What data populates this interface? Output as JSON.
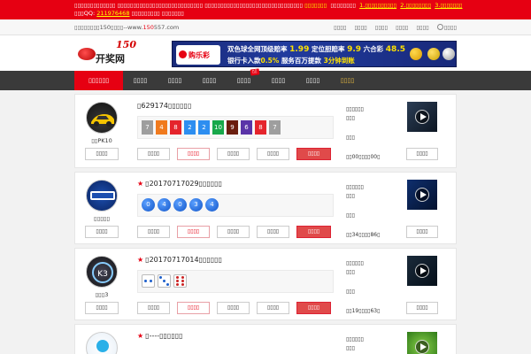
{
  "notice": {
    "text_a": "▯▯▯▯▯▯▯▯▯▯▯▯▯ ▯▯▯▯▯▯▯▯▯▯▯▯▯▯▯▯▯▯▯▯▯▯▯▯▯▯▯ ▯▯▯▯▯▯▯▯▯▯▯▯▯▯▯▯▯▯▯▯▯▯▯▯▯▯▯▯▯▯▯",
    "hl_1": "▯▯▯▯▯▯▯",
    "mid_1": "▯▯▯▯▯▯▯▯",
    "link_1": "1.▯▯▯▯▯▯▯▯▯▯",
    "link_2": "2.▯▯▯▯▯▯▯▯",
    "link_3": "3.▯▯▯▯▯▯▯",
    "text_b": "▯▯▯QQ: ",
    "qq": "211976468",
    "text_c": " ▯▯▯▯▯▯▯▯▯ ▯▯▯▯▯▯▯"
  },
  "toplinks": {
    "site_prefix": "▯▯▯▯▯▯▯▯150▯▯▯▯--www.",
    "site_num": "150",
    "site_suffix": "557.com",
    "links": [
      "▯▯▯▯",
      "▯▯▯▯",
      "▯▯▯▯",
      "▯▯▯▯",
      "▯▯▯▯"
    ],
    "user_label": "▯▯▯▯"
  },
  "logo": {
    "num": "150",
    "text": "开奖网"
  },
  "banner": {
    "brand": "购乐彩",
    "line1_a": "双色球全网顶级赔率",
    "line1_b": "1.99",
    "line1_c": "定位胆赔率",
    "line1_d": "9.9",
    "line1_e": "六合彩",
    "line1_f": "48.5",
    "line2_a": "银行卡入款",
    "line2_b": "0.5%",
    "line2_c": "服务百万提款",
    "line2_d": "3分钟到账"
  },
  "nav": {
    "items": [
      {
        "label": "▯▯▯▯▯▯",
        "active": true
      },
      {
        "label": "▯▯▯▯"
      },
      {
        "label": "▯▯▯▯"
      },
      {
        "label": "▯▯▯▯"
      },
      {
        "label": "▯▯▯▯",
        "badge": "▯▯"
      },
      {
        "label": "▯▯▯▯"
      },
      {
        "label": "▯▯▯▯"
      },
      {
        "label": "▯▯▯▯",
        "gold": true
      }
    ]
  },
  "cards": [
    {
      "name": "▯▯PK10",
      "issue": "▯629174▯▯▯▯▯▯",
      "left_btn": "▯▯▯▯",
      "actions": [
        "▯▯▯▯",
        "▯▯▯▯",
        "▯▯▯▯",
        "▯▯▯▯",
        "▯▯▯▯"
      ],
      "info1": "▯▯▯▯▯▯",
      "info2": "▯▯▯",
      "info3": "▯▯▯",
      "info4": "▯▯00▯▯▯▯00▯",
      "video_btn": "▯▯▯▯",
      "balls": [
        "7",
        "4",
        "8",
        "2",
        "2",
        "10",
        "9",
        "6",
        "8",
        "7"
      ]
    },
    {
      "name": "▯▯▯▯▯",
      "issue": "▯20170717029▯▯▯▯▯▯",
      "left_btn": "▯▯▯▯",
      "actions": [
        "▯▯▯▯",
        "▯▯▯▯",
        "▯▯▯▯",
        "▯▯▯▯",
        "▯▯▯▯"
      ],
      "info1": "▯▯▯▯▯▯",
      "info2": "▯▯▯",
      "info3": "▯▯▯",
      "info4": "▯▯34▯▯▯▯86▯",
      "video_btn": "▯▯▯▯",
      "balls": [
        "0",
        "4",
        "0",
        "3",
        "4"
      ]
    },
    {
      "name": "▯▯▯3",
      "issue": "▯20170717014▯▯▯▯▯▯",
      "left_btn": "▯▯▯▯",
      "actions": [
        "▯▯▯▯",
        "▯▯▯▯",
        "▯▯▯▯",
        "▯▯▯▯",
        "▯▯▯▯"
      ],
      "info1": "▯▯▯▯▯▯",
      "info2": "▯▯▯",
      "info3": "▯▯▯",
      "info4": "▯▯19▯▯▯▯63▯",
      "video_btn": "▯▯▯▯",
      "dice": [
        2,
        3,
        6
      ]
    },
    {
      "issue": "▯----▯▯▯▯▯▯",
      "info1": "▯▯▯▯▯▯",
      "info2": "▯▯▯"
    }
  ],
  "colors": {
    "red": "#e60012",
    "nav": "#3a3a3a",
    "ball_blue": "#1255c8",
    "pk10": [
      "#9e9e9e",
      "#f07a1e",
      "#e5242c",
      "#2d8ef0",
      "#2d8ef0",
      "#18a84a",
      "#6b1e0e",
      "#5a34a8",
      "#e5242c",
      "#9e9e9e"
    ]
  }
}
